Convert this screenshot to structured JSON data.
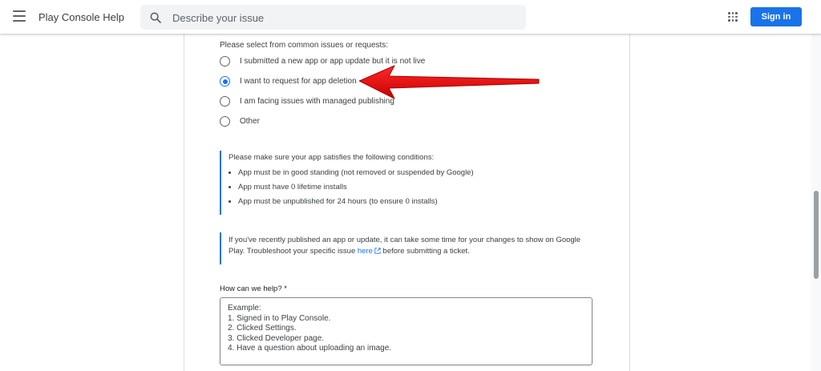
{
  "header": {
    "app_title": "Play Console Help",
    "search_placeholder": "Describe your issue",
    "signin_label": "Sign in",
    "signin_color": "#1a73e8"
  },
  "form": {
    "common_issues_label": "Please select from common issues or requests:",
    "options": [
      {
        "label": "I submitted a new app or app update but it is not live",
        "selected": false
      },
      {
        "label": "I want to request for app deletion",
        "selected": true
      },
      {
        "label": "I am facing issues with managed publishing",
        "selected": false
      },
      {
        "label": "Other",
        "selected": false
      }
    ],
    "conditions": {
      "heading": "Please make sure your app satisfies the following conditions:",
      "items": [
        "App must be in good standing (not removed or suspended by Google)",
        "App must have 0 lifetime installs",
        "App must be unpublished for 24 hours (to ensure 0 installs)"
      ]
    },
    "notice": {
      "text_before": "If you've recently published an app or update, it can take some time for your changes to show on Google Play. Troubleshoot your specific issue ",
      "link_text": "here",
      "text_after": " before submitting a ticket."
    },
    "help_label": "How can we help? *",
    "help_placeholder": "Example:\n1. Signed in to Play Console.\n2. Clicked Settings.\n3. Clicked Developer page.\n4. Have a question about uploading an image."
  },
  "annotation": {
    "arrow_color": "#e60000"
  }
}
